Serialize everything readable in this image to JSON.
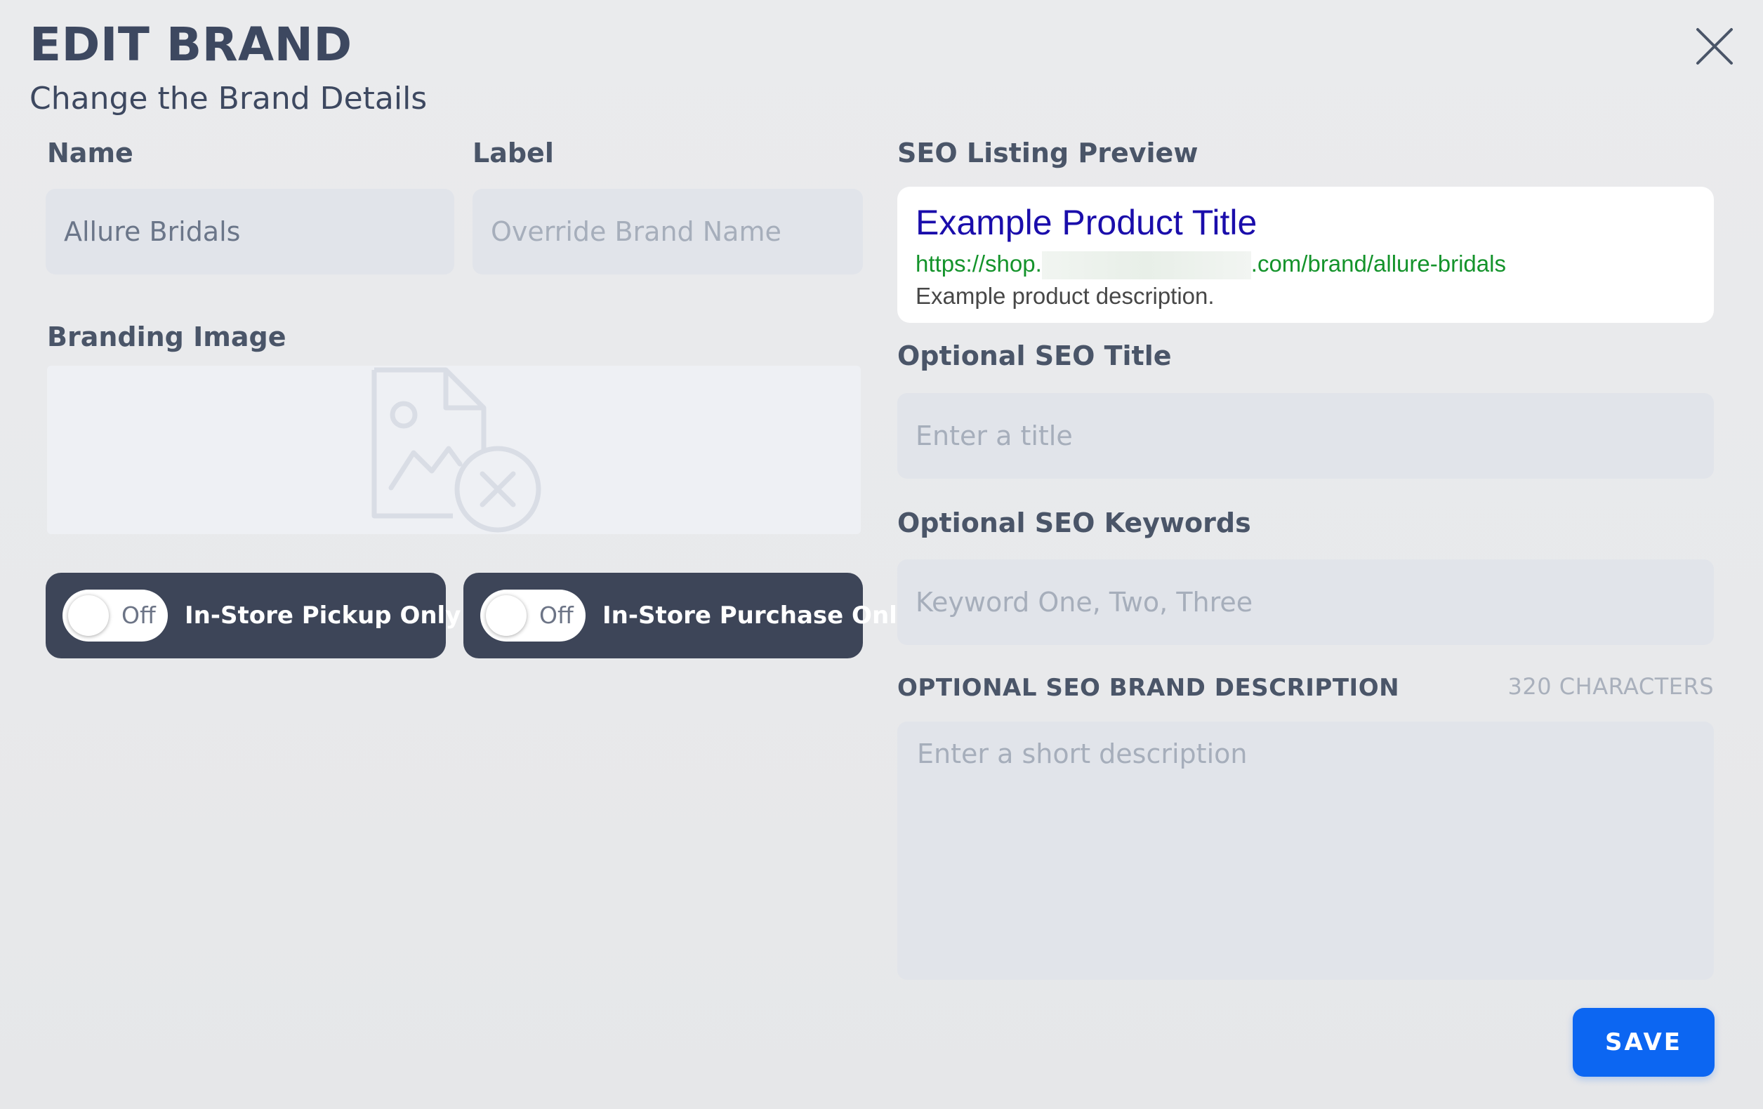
{
  "header": {
    "title": "EDIT BRAND",
    "subtitle": "Change the Brand Details"
  },
  "icons": {
    "close": "close-icon",
    "image_placeholder": "image-broken-icon"
  },
  "form": {
    "name": {
      "label": "Name",
      "value": "Allure Bridals"
    },
    "label": {
      "label": "Label",
      "placeholder": "Override Brand Name"
    },
    "branding_image": {
      "label": "Branding Image"
    },
    "toggles": [
      {
        "state": "Off",
        "label": "In-Store Pickup Only"
      },
      {
        "state": "Off",
        "label": "In-Store Purchase Only"
      }
    ]
  },
  "seo": {
    "preview_label": "SEO Listing Preview",
    "preview": {
      "title": "Example Product Title",
      "url_prefix": "https://shop.",
      "url_suffix": ".com/brand/allure-bridals",
      "description": "Example product description."
    },
    "title_field": {
      "label": "Optional SEO Title",
      "placeholder": "Enter a title"
    },
    "keywords_field": {
      "label": "Optional SEO Keywords",
      "placeholder": "Keyword One, Two, Three"
    },
    "description_field": {
      "label": "OPTIONAL SEO BRAND DESCRIPTION",
      "counter": "320 CHARACTERS",
      "placeholder": "Enter a short description"
    }
  },
  "actions": {
    "save_label": "SAVE"
  },
  "colors": {
    "accent": "#0c66f2",
    "toggle_card": "#3d4558",
    "seo_title_link": "#1a0dab",
    "seo_url": "#14932b"
  }
}
